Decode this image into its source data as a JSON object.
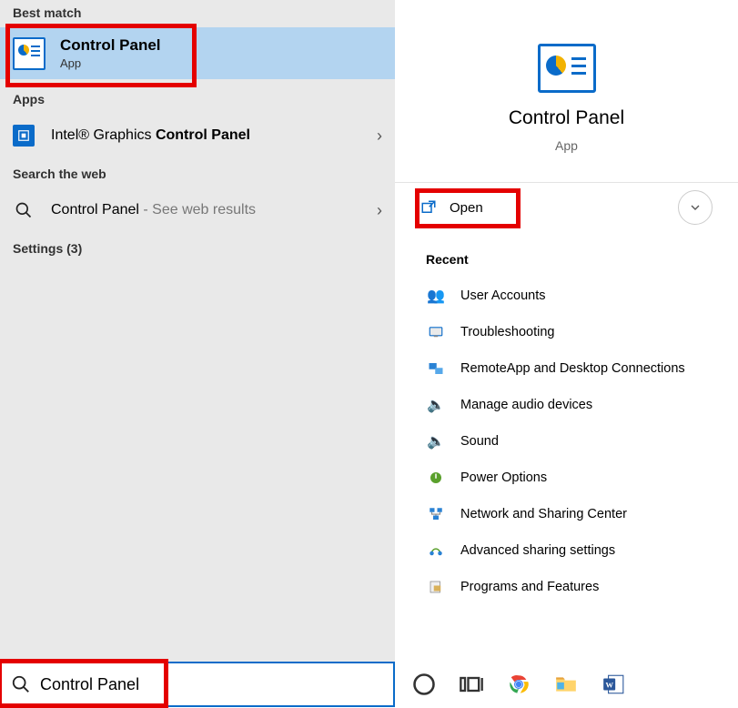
{
  "left": {
    "section_best": "Best match",
    "best_match": {
      "title": "Control Panel",
      "sub": "App"
    },
    "section_apps": "Apps",
    "apps": [
      {
        "prefix": "Intel® Graphics ",
        "bold": "Control Panel"
      }
    ],
    "section_web": "Search the web",
    "web": {
      "label": "Control Panel",
      "suffix": " - See web results"
    },
    "section_settings": "Settings (3)",
    "search_value": "Control Panel"
  },
  "right": {
    "hero_title": "Control Panel",
    "hero_sub": "App",
    "open_label": "Open",
    "recent_header": "Recent",
    "recent": [
      "User Accounts",
      "Troubleshooting",
      "RemoteApp and Desktop Connections",
      "Manage audio devices",
      "Sound",
      "Power Options",
      "Network and Sharing Center",
      "Advanced sharing settings",
      "Programs and Features"
    ]
  }
}
